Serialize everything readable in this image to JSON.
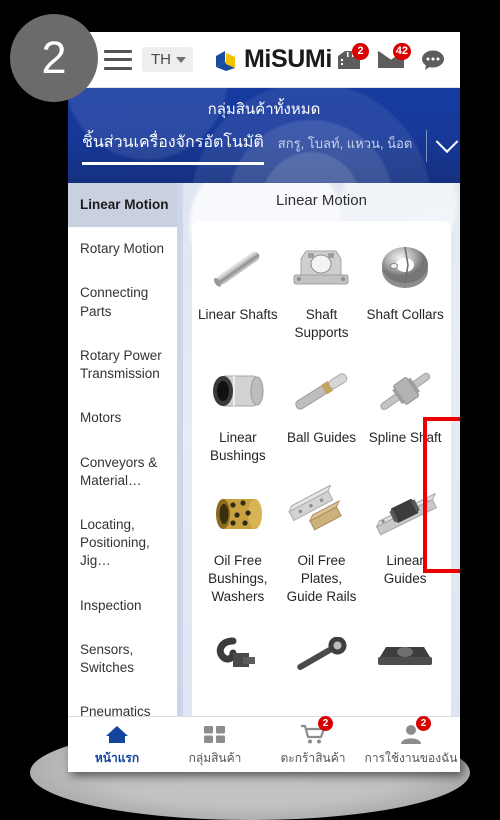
{
  "annotation": {
    "step_number": "2"
  },
  "header": {
    "menu_icon": "hamburger-menu-icon",
    "language": {
      "code": "TH",
      "caret": "chevron-down-icon"
    },
    "brand": {
      "name": "MiSUMi",
      "logo": "misumi-cube-logo",
      "colors": {
        "blue": "#1b4ba0",
        "yellow": "#f2c200"
      }
    },
    "icons": [
      {
        "name": "quotes-box-icon",
        "badge": "2"
      },
      {
        "name": "mail-envelope-icon",
        "badge": "42"
      },
      {
        "name": "chat-bubble-icon",
        "badge": ""
      }
    ]
  },
  "banner": {
    "title": "กลุ่มสินค้าทั้งหมด",
    "tab_active": "ชิ้นส่วนเครื่องจักรอัตโนมัติ",
    "tab_secondary": "สกรู, โบลท์, แหวน, น็อต",
    "expand_icon": "chevron-down-icon",
    "bg_color": "#163a9e"
  },
  "sidebar": {
    "items": [
      {
        "label": "Linear Motion",
        "active": true
      },
      {
        "label": "Rotary Motion",
        "active": false
      },
      {
        "label": "Connecting Parts",
        "active": false
      },
      {
        "label": "Rotary Power Transmission",
        "active": false
      },
      {
        "label": "Motors",
        "active": false
      },
      {
        "label": "Conveyors & Material…",
        "active": false
      },
      {
        "label": "Locating, Positioning, Jig…",
        "active": false
      },
      {
        "label": "Inspection",
        "active": false
      },
      {
        "label": "Sensors, Switches",
        "active": false
      },
      {
        "label": "Pneumatics",
        "active": false
      }
    ]
  },
  "panel": {
    "title": "Linear Motion",
    "highlight_color": "#ee0000",
    "highlighted_product": "Shaft Collars",
    "products": [
      {
        "label": "Linear Shafts",
        "icon": "linear-shaft-thumb"
      },
      {
        "label": "Shaft Supports",
        "icon": "shaft-support-thumb"
      },
      {
        "label": "Shaft Collars",
        "icon": "shaft-collar-thumb"
      },
      {
        "label": "Linear Bushings",
        "icon": "linear-bushing-thumb"
      },
      {
        "label": "Ball Guides",
        "icon": "ball-guide-thumb"
      },
      {
        "label": "Spline Shaft",
        "icon": "spline-shaft-thumb"
      },
      {
        "label": "Oil Free Bushings, Washers",
        "icon": "oil-free-bushing-thumb"
      },
      {
        "label": "Oil Free Plates, Guide Rails",
        "icon": "oil-free-plate-thumb"
      },
      {
        "label": "Linear Guides",
        "icon": "linear-guide-thumb"
      },
      {
        "label": "",
        "icon": "clamp-lever-thumb"
      },
      {
        "label": "",
        "icon": "rod-end-thumb"
      },
      {
        "label": "",
        "icon": "bearing-block-thumb"
      }
    ]
  },
  "bottom_nav": {
    "items": [
      {
        "label": "หน้าแรก",
        "icon": "home-icon",
        "active": true,
        "badge": ""
      },
      {
        "label": "กลุ่มสินค้า",
        "icon": "grid-categories-icon",
        "active": false,
        "badge": ""
      },
      {
        "label": "ตะกร้าสินค้า",
        "icon": "shopping-cart-icon",
        "active": false,
        "badge": "2"
      },
      {
        "label": "การใช้งานของฉัน",
        "icon": "user-account-icon",
        "active": false,
        "badge": "2"
      }
    ]
  }
}
